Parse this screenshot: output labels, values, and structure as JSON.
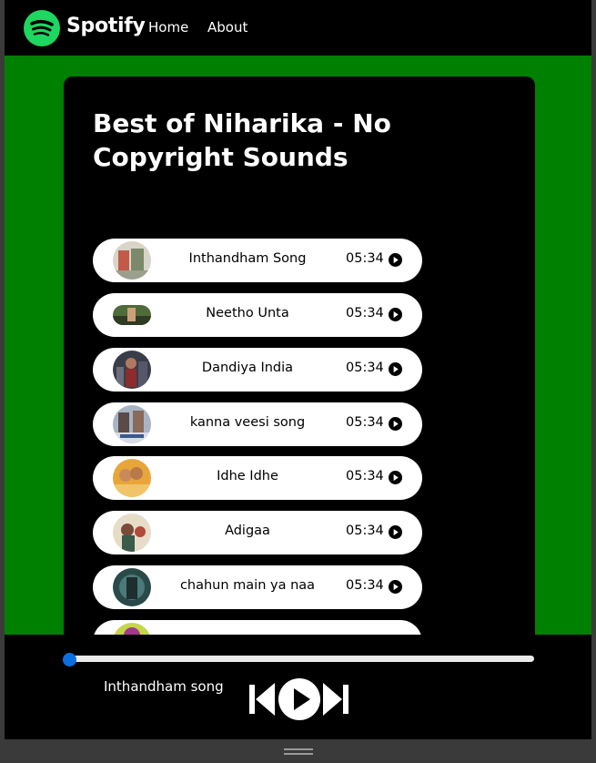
{
  "nav": {
    "brand": "Spotify",
    "links": [
      "Home",
      "About"
    ],
    "logo_icon": "spotify-logo-icon",
    "logo_color": "#1ed760"
  },
  "playlist": {
    "title": "Best of Niharika - No Copyright Sounds",
    "background_color": "#008000",
    "songs": [
      {
        "name": "Inthandham Song",
        "time": "05:34"
      },
      {
        "name": "Neetho Unta",
        "time": "05:34"
      },
      {
        "name": "Dandiya India",
        "time": "05:34"
      },
      {
        "name": "kanna veesi song",
        "time": "05:34"
      },
      {
        "name": "Idhe Idhe",
        "time": "05:34"
      },
      {
        "name": "Adigaa",
        "time": "05:34"
      },
      {
        "name": "chahun main ya naa",
        "time": "05:34"
      }
    ]
  },
  "player": {
    "now_playing": "Inthandham song",
    "progress": 0,
    "controls": [
      "previous-icon",
      "play-icon",
      "next-icon"
    ],
    "accent_color": "#0a6fe0"
  }
}
